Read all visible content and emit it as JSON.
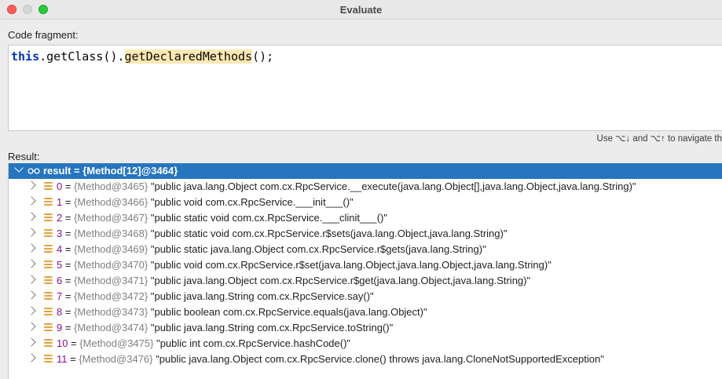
{
  "window": {
    "title": "Evaluate"
  },
  "code_fragment": {
    "label": "Code fragment:",
    "keyword": "this",
    "part1": ".getClass().",
    "highlighted": "getDeclaredMethods",
    "part2": "();"
  },
  "hint": "Use ⌥↓ and ⌥↑ to navigate th",
  "result": {
    "label": "Result:",
    "root": "result = {Method[12]@3464}",
    "items": [
      {
        "index": "0",
        "ref": "{Method@3465}",
        "value": "\"public java.lang.Object com.cx.RpcService.__execute(java.lang.Object[],java.lang.Object,java.lang.String)\""
      },
      {
        "index": "1",
        "ref": "{Method@3466}",
        "value": "\"public void com.cx.RpcService.___init___()\""
      },
      {
        "index": "2",
        "ref": "{Method@3467}",
        "value": "\"public static void com.cx.RpcService.___clinit___()\""
      },
      {
        "index": "3",
        "ref": "{Method@3468}",
        "value": "\"public static void com.cx.RpcService.r$sets(java.lang.Object,java.lang.String)\""
      },
      {
        "index": "4",
        "ref": "{Method@3469}",
        "value": "\"public static java.lang.Object com.cx.RpcService.r$gets(java.lang.String)\""
      },
      {
        "index": "5",
        "ref": "{Method@3470}",
        "value": "\"public void com.cx.RpcService.r$set(java.lang.Object,java.lang.Object,java.lang.String)\""
      },
      {
        "index": "6",
        "ref": "{Method@3471}",
        "value": "\"public java.lang.Object com.cx.RpcService.r$get(java.lang.Object,java.lang.String)\""
      },
      {
        "index": "7",
        "ref": "{Method@3472}",
        "value": "\"public java.lang.String com.cx.RpcService.say()\""
      },
      {
        "index": "8",
        "ref": "{Method@3473}",
        "value": "\"public boolean com.cx.RpcService.equals(java.lang.Object)\""
      },
      {
        "index": "9",
        "ref": "{Method@3474}",
        "value": "\"public java.lang.String com.cx.RpcService.toString()\""
      },
      {
        "index": "10",
        "ref": "{Method@3475}",
        "value": "\"public int com.cx.RpcService.hashCode()\""
      },
      {
        "index": "11",
        "ref": "{Method@3476}",
        "value": "\"public java.lang.Object com.cx.RpcService.clone() throws java.lang.CloneNotSupportedException\""
      }
    ]
  }
}
